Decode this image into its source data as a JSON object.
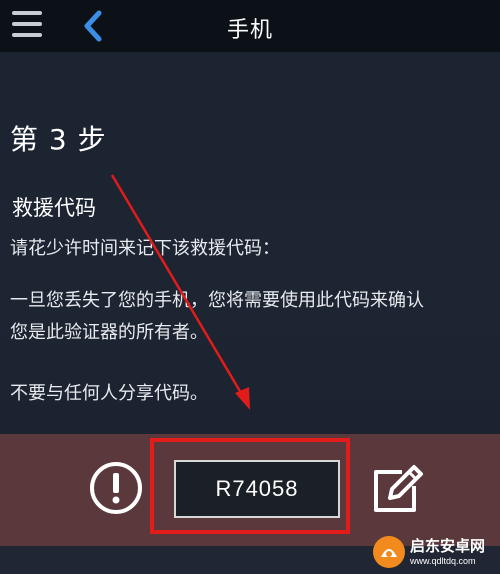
{
  "header": {
    "title": "手机",
    "menu_icon": "hamburger-menu-icon",
    "back_icon": "chevron-left-icon"
  },
  "content": {
    "step_heading": "第 3 步",
    "section_title": "救援代码",
    "instruction": "请花少许时间来记下该救援代码：",
    "explanation_line1": "一旦您丢失了您的手机，您将需要使用此代码来确认",
    "explanation_line2": "您是此验证器的所有者。",
    "warning": "不要与任何人分享代码。"
  },
  "code_panel": {
    "code": "R74058",
    "info_icon": "exclamation-circle-icon",
    "edit_icon": "edit-pencil-icon"
  },
  "annotation": {
    "arrow_color": "#e21b1b",
    "highlight_color": "#e21b1b"
  },
  "watermark": {
    "brand": "启东安卓网",
    "url": "www.qdltdq.com"
  },
  "colors": {
    "background": "#1b2230",
    "topbar": "#0c1118",
    "code_band": "#5a383c",
    "accent_blue": "#3a8ee6"
  }
}
